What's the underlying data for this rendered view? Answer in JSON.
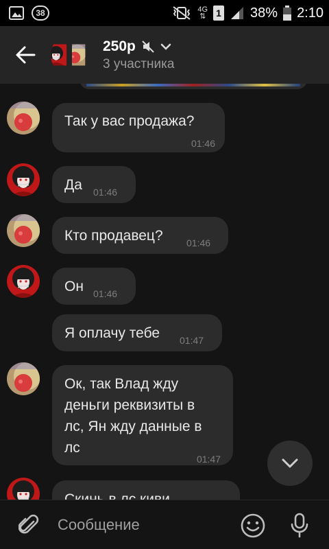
{
  "status_bar": {
    "notification_count": "38",
    "network": "4G",
    "sim_slot": "1",
    "battery": "38%",
    "time": "2:10"
  },
  "header": {
    "title": "250р",
    "subtitle": "3 участника"
  },
  "messages": [
    {
      "sender": "yellow",
      "text": "Так у вас продажа?",
      "time": "01:46"
    },
    {
      "sender": "girl",
      "text": "Да",
      "time": "01:46"
    },
    {
      "sender": "yellow",
      "text": "Кто продавец?",
      "time": "01:46"
    },
    {
      "sender": "girl",
      "text": "Он",
      "time": "01:46"
    },
    {
      "sender": "girl",
      "text": "Я оплачу тебе",
      "time": "01:47"
    },
    {
      "sender": "yellow",
      "text_lines": [
        "Ок, так Влад жду",
        "деньги реквизиты в",
        "лс, Ян жду данные в",
        "лс"
      ],
      "time": "01:47"
    },
    {
      "sender": "girl",
      "text": "Скинь в лс киви"
    }
  ],
  "composer": {
    "placeholder": "Сообщение"
  }
}
